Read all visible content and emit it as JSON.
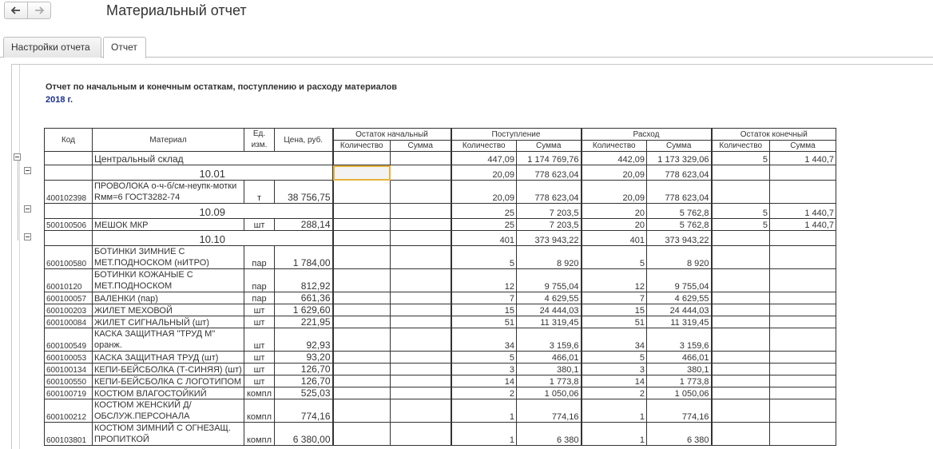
{
  "window": {
    "title": "Материальный отчет"
  },
  "tabs": [
    {
      "label": "Настройки отчета"
    },
    {
      "label": "Отчет"
    }
  ],
  "report": {
    "title": "Отчет по начальным и конечным остаткам, поступлению и расходу материалов",
    "period": "2018 г.",
    "headers": {
      "code": "Код",
      "material": "Материал",
      "unit": "Ед. изм.",
      "price": "Цена, руб.",
      "opening": "Остаток начальный",
      "receipt": "Поступление",
      "expense": "Расход",
      "closing": "Остаток конечный",
      "qty": "Количество",
      "sum": "Сумма"
    },
    "warehouse": {
      "name": "Центральный склад",
      "receipt_qty": "447,09",
      "receipt_sum": "1 174 769,76",
      "expense_qty": "442,09",
      "expense_sum": "1 173 329,06",
      "closing_qty": "5",
      "closing_sum": "1 440,7"
    },
    "group1": {
      "name": "10.01",
      "receipt_qty": "20,09",
      "receipt_sum": "778 623,04",
      "expense_qty": "20,09",
      "expense_sum": "778 623,04"
    },
    "g1_rows": [
      {
        "code": "400102398",
        "material": "ПРОВОЛОКА о-ч-б/см-неупк-мотки Rмм=6 ГОСТ3282-74",
        "unit": "т",
        "price": "38 756,75",
        "receipt_qty": "20,09",
        "receipt_sum": "778 623,04",
        "expense_qty": "20,09",
        "expense_sum": "778 623,04"
      }
    ],
    "group2": {
      "name": "10.09",
      "receipt_qty": "25",
      "receipt_sum": "7 203,5",
      "expense_qty": "20",
      "expense_sum": "5 762,8",
      "closing_qty": "5",
      "closing_sum": "1 440,7"
    },
    "g2_rows": [
      {
        "code": "500100506",
        "material": "МЕШОК МКР",
        "unit": "шт",
        "price": "288,14",
        "receipt_qty": "25",
        "receipt_sum": "7 203,5",
        "expense_qty": "20",
        "expense_sum": "5 762,8",
        "closing_qty": "5",
        "closing_sum": "1 440,7"
      }
    ],
    "group3": {
      "name": "10.10",
      "receipt_qty": "401",
      "receipt_sum": "373 943,22",
      "expense_qty": "401",
      "expense_sum": "373 943,22"
    },
    "g3_rows": [
      {
        "code": "600100580",
        "material": "БОТИНКИ ЗИМНИЕ С МЕТ.ПОДНОСКОМ (нИТРО)",
        "unit": "пар",
        "price": "1 784,00",
        "receipt_qty": "5",
        "receipt_sum": "8 920",
        "expense_qty": "5",
        "expense_sum": "8 920"
      },
      {
        "code": "60010120",
        "material": "БОТИНКИ КОЖАНЫЕ С МЕТ.ПОДНОСКОМ",
        "unit": "пар",
        "price": "812,92",
        "receipt_qty": "12",
        "receipt_sum": "9 755,04",
        "expense_qty": "12",
        "expense_sum": "9 755,04"
      },
      {
        "code": "600100057",
        "material": "ВАЛЕНКИ (пар)",
        "unit": "пар",
        "price": "661,36",
        "receipt_qty": "7",
        "receipt_sum": "4 629,55",
        "expense_qty": "7",
        "expense_sum": "4 629,55"
      },
      {
        "code": "600100203",
        "material": "ЖИЛЕТ МЕХОВОЙ",
        "unit": "шт",
        "price": "1 629,60",
        "receipt_qty": "15",
        "receipt_sum": "24 444,03",
        "expense_qty": "15",
        "expense_sum": "24 444,03"
      },
      {
        "code": "600100084",
        "material": "ЖИЛЕТ СИГНАЛЬНЫЙ (шт)",
        "unit": "шт",
        "price": "221,95",
        "receipt_qty": "51",
        "receipt_sum": "11 319,45",
        "expense_qty": "51",
        "expense_sum": "11 319,45"
      },
      {
        "code": "600100549",
        "material": "КАСКА ЗАЩИТНАЯ \"ТРУД М\" оранж.",
        "unit": "шт",
        "price": "92,93",
        "receipt_qty": "34",
        "receipt_sum": "3 159,6",
        "expense_qty": "34",
        "expense_sum": "3 159,6"
      },
      {
        "code": "600100053",
        "material": "КАСКА ЗАЩИТНАЯ ТРУД (шт)",
        "unit": "шт",
        "price": "93,20",
        "receipt_qty": "5",
        "receipt_sum": "466,01",
        "expense_qty": "5",
        "expense_sum": "466,01"
      },
      {
        "code": "600100134",
        "material": "КЕПИ-БЕЙСБОЛКА (Т-СИНЯЯ) (шт)",
        "unit": "шт",
        "price": "126,70",
        "receipt_qty": "3",
        "receipt_sum": "380,1",
        "expense_qty": "3",
        "expense_sum": "380,1"
      },
      {
        "code": "600100550",
        "material": "КЕПИ-БЕЙСБОЛКА С ЛОГОТИПОМ",
        "unit": "шт",
        "price": "126,70",
        "receipt_qty": "14",
        "receipt_sum": "1 773,8",
        "expense_qty": "14",
        "expense_sum": "1 773,8"
      },
      {
        "code": "600100719",
        "material": "КОСТЮМ ВЛАГОСТОЙКИЙ",
        "unit": "компл",
        "price": "525,03",
        "receipt_qty": "2",
        "receipt_sum": "1 050,06",
        "expense_qty": "2",
        "expense_sum": "1 050,06"
      },
      {
        "code": "600100212",
        "material": "КОСТЮМ ЖЕНСКИЙ Д/ОБСЛУЖ.ПЕРСОНАЛА",
        "unit": "компл",
        "price": "774,16",
        "receipt_qty": "1",
        "receipt_sum": "774,16",
        "expense_qty": "1",
        "expense_sum": "774,16"
      },
      {
        "code": "600103801",
        "material": "КОСТЮМ ЗИМНИЙ С ОГНЕЗАЩ. ПРОПИТКОЙ",
        "unit": "компл",
        "price": "6 380,00",
        "receipt_qty": "1",
        "receipt_sum": "6 380",
        "expense_qty": "1",
        "expense_sum": "6 380"
      }
    ]
  }
}
